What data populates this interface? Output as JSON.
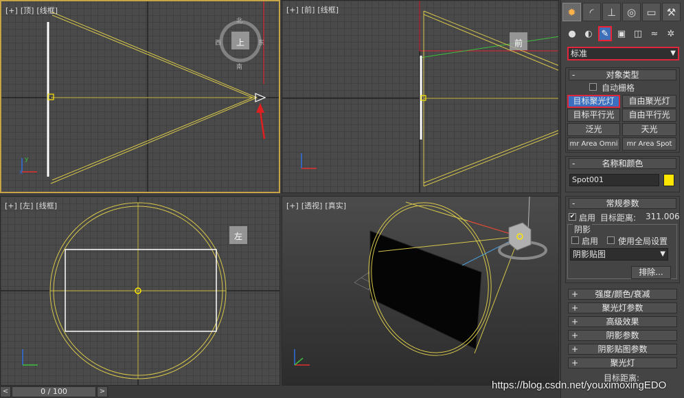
{
  "viewports": {
    "top": {
      "labels": [
        "[+]",
        "[顶]",
        "[线框]"
      ],
      "cube_face": "上",
      "compass": {
        "north": "北",
        "south": "南",
        "east": "东",
        "west": "西"
      }
    },
    "front": {
      "labels": [
        "[+]",
        "[前]",
        "[线框]"
      ],
      "cube_face": "前"
    },
    "left": {
      "labels": [
        "[+]",
        "[左]",
        "[线框]"
      ],
      "cube_face": "左"
    },
    "perspective": {
      "labels": [
        "[+]",
        "[透视]",
        "[真实]"
      ]
    }
  },
  "command_panel": {
    "tabs": [
      "create",
      "modify",
      "hierarchy",
      "motion",
      "display",
      "utilities"
    ],
    "active_tab": "create",
    "subcategories": [
      "geometry",
      "shapes",
      "lights",
      "cameras",
      "helpers",
      "space-warps",
      "systems"
    ],
    "active_subcategory": "lights",
    "type_dropdown": "标准",
    "object_type": {
      "title": "对象类型",
      "toggle": "-",
      "autogrid": {
        "label": "自动栅格",
        "checked": false
      },
      "buttons": [
        "目标聚光灯",
        "自由聚光灯",
        "目标平行光",
        "自由平行光",
        "泛光",
        "天光",
        "mr Area Omni",
        "mr Area Spot"
      ],
      "selected": "目标聚光灯"
    },
    "name_color": {
      "title": "名称和颜色",
      "toggle": "-",
      "name": "Spot001",
      "color": "#ffe600"
    },
    "general": {
      "title": "常规参数",
      "toggle": "-",
      "on_label": "启用",
      "on_checked": true,
      "target_distance_label": "目标距离:",
      "target_distance_value": "311.006",
      "shadows_label": "阴影",
      "shadow_on_label": "启用",
      "shadow_on_checked": false,
      "global_settings_label": "使用全局设置",
      "global_settings_checked": false,
      "shadow_type": "阴影贴图",
      "exclude_button": "排除..."
    },
    "collapsed_rollouts": [
      {
        "toggle": "+",
        "title": "强度/颜色/衰减"
      },
      {
        "toggle": "+",
        "title": "聚光灯参数"
      },
      {
        "toggle": "+",
        "title": "高级效果"
      },
      {
        "toggle": "+",
        "title": "阴影参数"
      },
      {
        "toggle": "+",
        "title": "阴影贴图参数"
      },
      {
        "toggle": "+",
        "title": "聚光灯"
      }
    ],
    "bottom_text": "目标距离:"
  },
  "timeline": {
    "prev": "<",
    "next": ">",
    "value": "0 / 100"
  },
  "watermark": "https://blog.csdn.net/youximoxingEDO",
  "colors": {
    "light_wire": "#d8c84a",
    "active_border": "#c7a34a",
    "selection_red": "#e0263a",
    "x_axis": "#e03030",
    "y_axis": "#30c030",
    "z_axis": "#3070e0"
  }
}
